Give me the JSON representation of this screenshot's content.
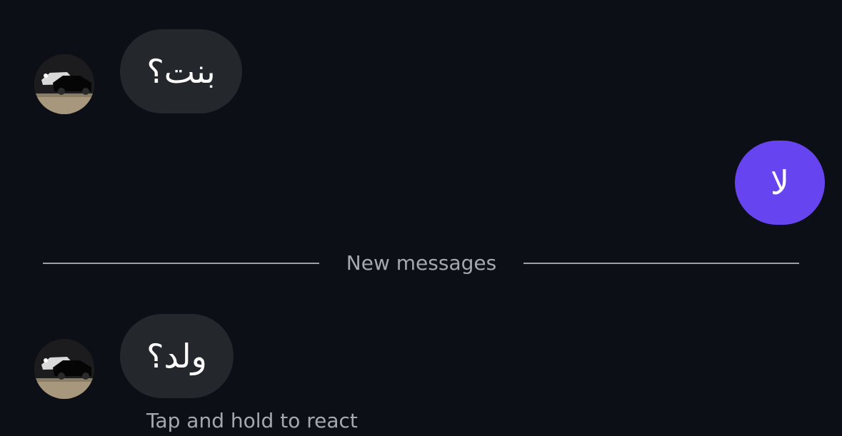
{
  "messages": [
    {
      "sender": "other",
      "text": "بنت؟"
    },
    {
      "sender": "me",
      "text": "لا"
    },
    {
      "sender": "other",
      "text": "ولد؟"
    }
  ],
  "divider": {
    "label": "New messages"
  },
  "hint": {
    "text": "Tap and hold to react"
  },
  "colors": {
    "background": "#0c0f15",
    "incoming_bubble": "#24272c",
    "outgoing_bubble": "#6645f0",
    "secondary_text": "#a6a8ad"
  }
}
